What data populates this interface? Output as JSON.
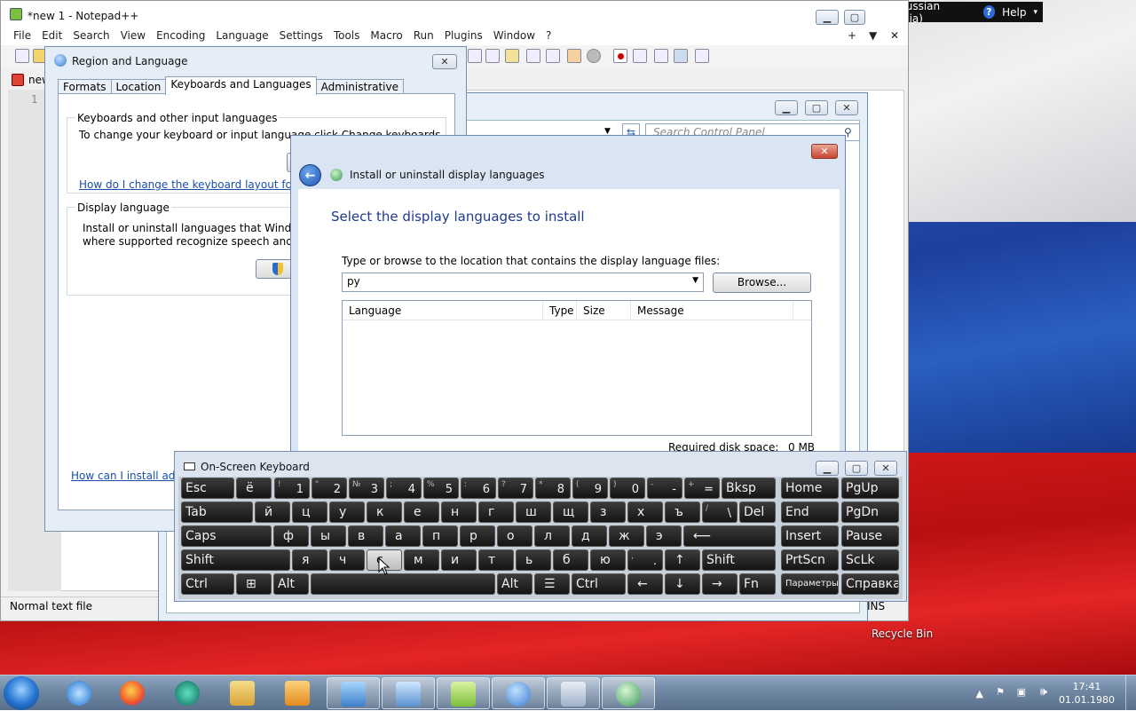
{
  "desktop": {
    "recycle_bin_label": "Recycle Bin"
  },
  "langbar": {
    "language": "RU Russian (Russia)",
    "help_label": "Help"
  },
  "notepad": {
    "title": "*new 1 - Notepad++",
    "menu": [
      "File",
      "Edit",
      "Search",
      "View",
      "Encoding",
      "Language",
      "Settings",
      "Tools",
      "Macro",
      "Run",
      "Plugins",
      "Window",
      "?"
    ],
    "tab_label": "new",
    "line_number": "1",
    "status_text": "Normal text file",
    "status_right": "INS"
  },
  "control_panel": {
    "search_placeholder": "Search Control Panel"
  },
  "region_dialog": {
    "title": "Region and Language",
    "tabs": [
      "Formats",
      "Location",
      "Keyboards and Languages",
      "Administrative"
    ],
    "keyboards_group": "Keyboards and other input languages",
    "keyboards_text": "To change your keyboard or input language click Change keyboards",
    "keyboards_link": "How do I change the keyboard layout for the",
    "display_group": "Display language",
    "display_text_1": "Install or uninstall languages that Windows c",
    "display_text_2": "where supported recognize speech and hand",
    "install_link": "How can I install addi"
  },
  "wizard": {
    "title": "Install or uninstall display languages",
    "heading": "Select the display languages to install",
    "path_label": "Type or browse to the location that contains the display language files:",
    "path_value": "ру",
    "browse_label": "Browse...",
    "columns": [
      "Language",
      "Type",
      "Size",
      "Message"
    ],
    "disk_space_label": "Required disk space:",
    "disk_space_value": "0 MB"
  },
  "osk": {
    "title": "On-Screen Keyboard",
    "rows": [
      [
        {
          "main": "Esc"
        },
        {
          "main": "ё"
        },
        {
          "sub": "!",
          "main": "1"
        },
        {
          "sub": "\"",
          "main": "2"
        },
        {
          "sub": "№",
          "main": "3"
        },
        {
          "sub": ";",
          "main": "4"
        },
        {
          "sub": "%",
          "main": "5"
        },
        {
          "sub": ":",
          "main": "6"
        },
        {
          "sub": "?",
          "main": "7"
        },
        {
          "sub": "*",
          "main": "8"
        },
        {
          "sub": "(",
          "main": "9"
        },
        {
          "sub": ")",
          "main": "0"
        },
        {
          "sub": "-",
          "main": "-"
        },
        {
          "sub": "+",
          "main": "="
        },
        {
          "main": "Bksp"
        },
        {
          "main": "Home"
        },
        {
          "main": "PgUp"
        }
      ],
      [
        {
          "main": "Tab"
        },
        {
          "main": "й"
        },
        {
          "main": "ц"
        },
        {
          "main": "у"
        },
        {
          "main": "к"
        },
        {
          "main": "е"
        },
        {
          "main": "н"
        },
        {
          "main": "г"
        },
        {
          "main": "ш"
        },
        {
          "main": "щ"
        },
        {
          "main": "з"
        },
        {
          "main": "х"
        },
        {
          "main": "ъ"
        },
        {
          "sub": "/",
          "main": "\\"
        },
        {
          "main": "Del"
        },
        {
          "main": "End"
        },
        {
          "main": "PgDn"
        }
      ],
      [
        {
          "main": "Caps"
        },
        {
          "main": "ф"
        },
        {
          "main": "ы"
        },
        {
          "main": "в"
        },
        {
          "main": "а"
        },
        {
          "main": "п"
        },
        {
          "main": "р"
        },
        {
          "main": "о"
        },
        {
          "main": "л"
        },
        {
          "main": "д"
        },
        {
          "main": "ж"
        },
        {
          "main": "э"
        },
        {
          "main": "⟵"
        },
        {
          "main": "Insert"
        },
        {
          "main": "Pause"
        }
      ],
      [
        {
          "main": "Shift"
        },
        {
          "main": "я"
        },
        {
          "main": "ч"
        },
        {
          "main": "с"
        },
        {
          "main": "м"
        },
        {
          "main": "и"
        },
        {
          "main": "т"
        },
        {
          "main": "ь"
        },
        {
          "main": "б"
        },
        {
          "main": "ю"
        },
        {
          "sub": ",",
          "main": "."
        },
        {
          "main": "↑"
        },
        {
          "main": "Shift"
        },
        {
          "main": "PrtScn"
        },
        {
          "main": "ScLk"
        }
      ],
      [
        {
          "main": "Ctrl"
        },
        {
          "main": "⊞"
        },
        {
          "main": "Alt"
        },
        {
          "main": ""
        },
        {
          "main": "Alt"
        },
        {
          "main": "☰"
        },
        {
          "main": "Ctrl"
        },
        {
          "main": "←"
        },
        {
          "main": "↓"
        },
        {
          "main": "→"
        },
        {
          "main": "Fn"
        },
        {
          "main": "Параметры"
        },
        {
          "main": "Справка"
        }
      ]
    ]
  },
  "taskbar": {
    "time": "17:41",
    "date": "01.01.1980"
  }
}
